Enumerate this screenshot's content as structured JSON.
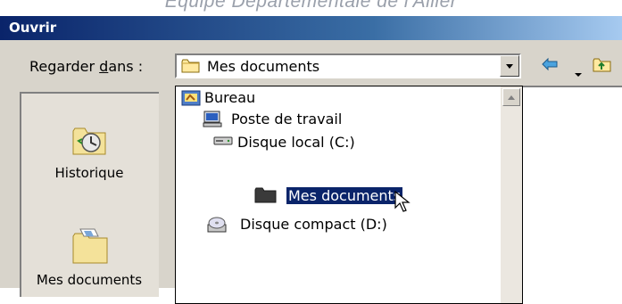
{
  "page_caption": "Equipe Départementale de l'Allier",
  "dialog": {
    "title": "Ouvrir"
  },
  "look_in": {
    "label_before": "Regarder ",
    "label_accel": "d",
    "label_after": "ans :",
    "value": "Mes documents"
  },
  "toolbar": {
    "icons": [
      "back-arrow-icon",
      "dropdown-arrow-icon",
      "up-folder-icon"
    ]
  },
  "places_bar": {
    "items": [
      {
        "label": "Historique",
        "icon": "history-icon"
      },
      {
        "label": "Mes documents",
        "icon": "my-documents-icon"
      }
    ]
  },
  "dropdown": {
    "items": [
      {
        "label": "Bureau",
        "icon": "desktop-icon",
        "level": 0,
        "selected": false
      },
      {
        "label": "Poste de travail",
        "icon": "computer-icon",
        "level": 1,
        "selected": false
      },
      {
        "label": "Disque local (C:)",
        "icon": "hard-drive-icon",
        "level": 2,
        "selected": false
      },
      {
        "label": "Mes documents",
        "icon": "folder-icon",
        "level": 3,
        "selected": true
      },
      {
        "label": "Disque compact (D:)",
        "icon": "cd-drive-icon",
        "level": 1,
        "selected": false
      }
    ]
  },
  "colors": {
    "titlebar_start": "#0a246a",
    "titlebar_end": "#a6caf0",
    "selection": "#0a246a",
    "dialog_face": "#d8d4cb"
  }
}
